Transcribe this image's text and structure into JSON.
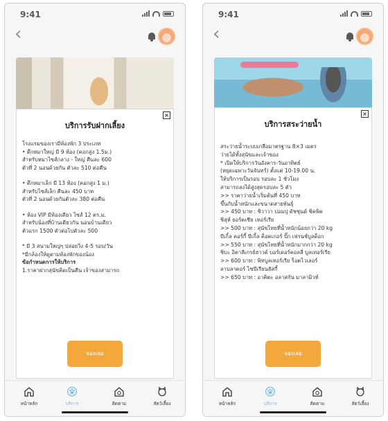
{
  "screens": [
    {
      "status_time": "9:41",
      "modal": {
        "title": "บริการรับฝากเลี้ยง",
        "book_label": "จองเลย",
        "lines": [
          {
            "text": "โรงแรมของเรามีห้องพัก 3 ประเภท"
          },
          {
            "text": "  • ตึกหมาใหญ่ มี 9 ห้อง (คอกสูง 1.5ม.)"
          },
          {
            "text": "สำหรับหมาไซส์กลาง - ใหญ่ คืนละ 600"
          },
          {
            "text": "ตัวที่ 2 นอนด้วยกัน ตัวละ 510 ต่อคืน"
          },
          {
            "text": ""
          },
          {
            "text": "  • ตึกหมาเล็ก มี 13 ห้อง (คอกสูง 1 ม.)"
          },
          {
            "text": "สำหรับไซส์เล็ก คืนละ 450 บาท"
          },
          {
            "text": "ตัวที่ 2 นอนด้วยกันตัวละ 380 ต่อคืน"
          },
          {
            "text": ""
          },
          {
            "text": "  • ห้อง VIP มีห้องเดียว ไซส์ 12 ตร.ม."
          },
          {
            "text": "สำหรับน้องที่บ้านเดียวกัน นอนบ้านเดียว"
          },
          {
            "text": "ตัวแรก 1500 ตัวต่อไปตัวละ 500"
          },
          {
            "text": ""
          },
          {
            "text": "* มี 3 สนามใหญ่ๆ ปล่อยวิ่ง 4-5 รอบ/วัน"
          },
          {
            "text": "*มีกล้องให้ดูตามห้องพักของน้อง"
          },
          {
            "text": "ข้อกำหนดการให้บริการ",
            "bold": true
          },
          {
            "text": "1.ราคาฝากสุนัขคิดเป็นคืน เจ้าของสามารถ"
          }
        ]
      },
      "tabs": [
        {
          "label": "หน้าหลัก",
          "icon": "home-icon"
        },
        {
          "label": "บริการ",
          "icon": "paw-icon"
        },
        {
          "label": "ติดตาม",
          "icon": "track-icon"
        },
        {
          "label": "สัตว์เลี้ยง",
          "icon": "pet-icon"
        }
      ],
      "active_tab": 1
    },
    {
      "status_time": "9:41",
      "modal": {
        "title": "บริการสระว่ายน้ำ",
        "book_label": "จองเลย",
        "lines": [
          {
            "text": "สระว่ายน้ำระบบเกลือมาตรฐาน 8×3 เมตร"
          },
          {
            "text": "ว่ายได้ทั้งสุนัขและเจ้าของ"
          },
          {
            "text": "* เปิดให้บริการวันอังคาร-วันอาทิตย์"
          },
          {
            "text": "(หยุดเฉพาะวันจันทร์) ตั้งแต่ 10-19.00 น."
          },
          {
            "text": "ให้บริการเป็นรอบ รอบละ 1 ชั่วโมง"
          },
          {
            "text": "สามารถลงได้สูงสุดรอบละ 5 ตัว"
          },
          {
            "text": ">> ราคาว่ายน้ำเริ่มต้นที่ 450 บาท"
          },
          {
            "text": "ขึ้นกับน้ำหนักและขนาดสายพันธุ์"
          },
          {
            "text": ">> 450 บาท : ชิวาวา ปอมปุ ดัชชุนด์ ชิคพิค"
          },
          {
            "text": "ชิสุห์ ยอร์คเชีย เทอร์เรีย"
          },
          {
            "text": ">> 500 บาท : สุนัขไทยที่น้ำหนักน้อยกว่า 20 kg"
          },
          {
            "text": "บีเกิ้ล คอร์กี้ บีเกิ้ล ค็อคเกอร์ ปั๊ก เฟรนช์บูลด็อก"
          },
          {
            "text": ">> 550 บาท : สุนัขไทยที่น้ำหนักมากกว่า 20 kg"
          },
          {
            "text": "ชิบะ อิตาลีเกรย์ฮาวด์ บอร์เดอร์คอลลี่ บูลเทอร์เรีย"
          },
          {
            "text": ">> 600 บาท : พิทบูลเทอร์เรีย ร็อตไวเลอร์"
          },
          {
            "text": "ลาบลาดอร์ ไซบีเรียนฮัสกี้"
          },
          {
            "text": ">> 650 บาท : อาคิตะ อลาสกัน มาลามิวท์"
          }
        ]
      },
      "tabs": [
        {
          "label": "หน้าหลัก",
          "icon": "home-icon"
        },
        {
          "label": "บริการ",
          "icon": "paw-icon"
        },
        {
          "label": "ติดตาม",
          "icon": "track-icon"
        },
        {
          "label": "สัตว์เลี้ยง",
          "icon": "pet-icon"
        }
      ],
      "active_tab": 1
    }
  ],
  "colors": {
    "accent": "#f4a73b",
    "active_tab": "#79b8e0",
    "close_x": "×"
  }
}
